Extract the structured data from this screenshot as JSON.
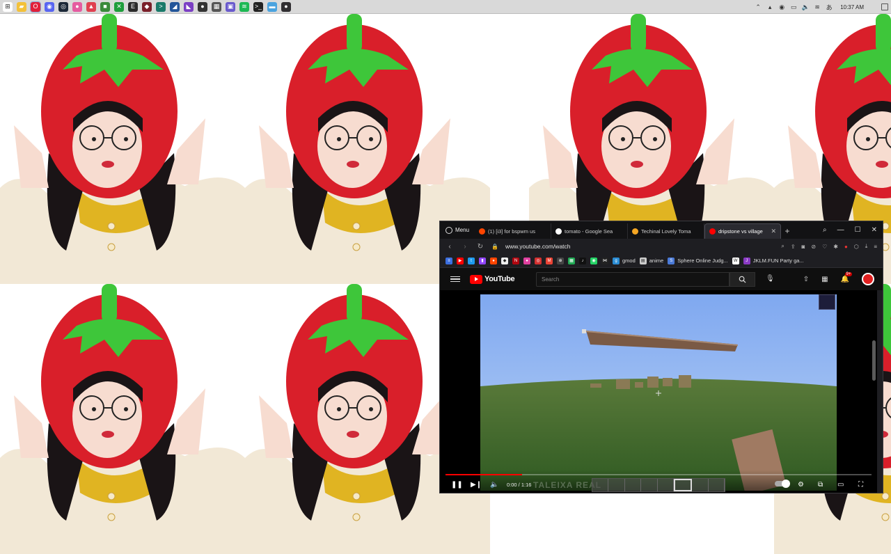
{
  "taskbar": {
    "apps": [
      {
        "name": "start-icon",
        "color": "#ffffff",
        "glyph": "⊞",
        "active": false
      },
      {
        "name": "file-explorer-icon",
        "color": "#f3c13a",
        "glyph": "▰",
        "active": false
      },
      {
        "name": "opera-icon",
        "color": "#e1203a",
        "glyph": "O",
        "active": true
      },
      {
        "name": "discord-icon",
        "color": "#5865f2",
        "glyph": "◉",
        "active": false
      },
      {
        "name": "steam-icon",
        "color": "#1b2838",
        "glyph": "◎",
        "active": false
      },
      {
        "name": "osu-icon",
        "color": "#e55ba0",
        "glyph": "●",
        "active": false
      },
      {
        "name": "app-red-icon",
        "color": "#e04050",
        "glyph": "▲",
        "active": false
      },
      {
        "name": "minecraft-icon",
        "color": "#3a8a3a",
        "glyph": "■",
        "active": false
      },
      {
        "name": "xbox-icon",
        "color": "#1e9e3b",
        "glyph": "✕",
        "active": false
      },
      {
        "name": "epic-games-icon",
        "color": "#2a2a2a",
        "glyph": "E",
        "active": false
      },
      {
        "name": "app-dark-icon",
        "color": "#7a1f2a",
        "glyph": "◆",
        "active": false
      },
      {
        "name": "terminal-app-icon",
        "color": "#1a7a6a",
        "glyph": ">",
        "active": false
      },
      {
        "name": "app-blue-icon",
        "color": "#225599",
        "glyph": "◢",
        "active": false
      },
      {
        "name": "visual-studio-icon",
        "color": "#7b3fc4",
        "glyph": "◣",
        "active": false
      },
      {
        "name": "github-icon",
        "color": "#333333",
        "glyph": "●",
        "active": false
      },
      {
        "name": "app-gray-icon",
        "color": "#555555",
        "glyph": "▦",
        "active": false
      },
      {
        "name": "app-purple-icon",
        "color": "#6a5acd",
        "glyph": "▣",
        "active": false
      },
      {
        "name": "spotify-icon",
        "color": "#1db954",
        "glyph": "≋",
        "active": false
      },
      {
        "name": "cmd-icon",
        "color": "#222222",
        "glyph": ">_",
        "active": false
      },
      {
        "name": "app-lightblue-icon",
        "color": "#4aa3df",
        "glyph": "▬",
        "active": false
      },
      {
        "name": "obs-icon",
        "color": "#302e31",
        "glyph": "●",
        "active": false
      }
    ],
    "tray": [
      {
        "name": "chevron-up-icon",
        "glyph": "⌃"
      },
      {
        "name": "tray-app-icon",
        "glyph": "▴"
      },
      {
        "name": "discord-tray-icon",
        "glyph": "◉"
      },
      {
        "name": "monitor-icon",
        "glyph": "▭"
      },
      {
        "name": "volume-icon",
        "glyph": "🔈"
      },
      {
        "name": "wifi-icon",
        "glyph": "≋"
      },
      {
        "name": "language-icon",
        "glyph": "あ"
      }
    ],
    "clock": "10:37 AM"
  },
  "browser": {
    "menu_label": "Menu",
    "tabs": [
      {
        "title": "(1) [i3] for bspwm us",
        "favicon_color": "#ff4500",
        "active": false
      },
      {
        "title": "tomato - Google Sea",
        "favicon_color": "#ffffff",
        "active": false
      },
      {
        "title": "Techinal Lovely Toma",
        "favicon_color": "#f5a623",
        "active": false
      },
      {
        "title": "dripstone vs village",
        "favicon_color": "#ff0000",
        "active": true
      }
    ],
    "url": "www.youtube.com/watch",
    "bookmarks": [
      {
        "name": "bookmark-blue-icon",
        "color": "#3b6fe0",
        "glyph": "≡",
        "label": ""
      },
      {
        "name": "bookmark-youtube-icon",
        "color": "#ff0000",
        "glyph": "▶",
        "label": ""
      },
      {
        "name": "bookmark-twitter-icon",
        "color": "#1d9bf0",
        "glyph": "t",
        "label": ""
      },
      {
        "name": "bookmark-twitch-icon",
        "color": "#9146ff",
        "glyph": "▮",
        "label": ""
      },
      {
        "name": "bookmark-reddit-icon",
        "color": "#ff4500",
        "glyph": "●",
        "label": ""
      },
      {
        "name": "bookmark-roblox-icon",
        "color": "#eeeeee",
        "glyph": "◆",
        "label": ""
      },
      {
        "name": "bookmark-netflix-icon",
        "color": "#b00710",
        "glyph": "N",
        "label": ""
      },
      {
        "name": "bookmark-pink-icon",
        "color": "#e040a0",
        "glyph": "●",
        "label": ""
      },
      {
        "name": "bookmark-red-icon",
        "color": "#d33030",
        "glyph": "◎",
        "label": ""
      },
      {
        "name": "bookmark-gmail-icon",
        "color": "#ea4335",
        "glyph": "M",
        "label": ""
      },
      {
        "name": "bookmark-spotify-icon",
        "color": "#444444",
        "glyph": "⊕",
        "label": ""
      },
      {
        "name": "bookmark-green-icon",
        "color": "#22aa55",
        "glyph": "▦",
        "label": ""
      },
      {
        "name": "bookmark-tiktok-icon",
        "color": "#111111",
        "glyph": "♪",
        "label": ""
      },
      {
        "name": "bookmark-whatsapp-icon",
        "color": "#25d366",
        "glyph": "◉",
        "label": ""
      },
      {
        "name": "bookmark-bow-icon",
        "color": "#222222",
        "glyph": "⋈",
        "label": ""
      },
      {
        "name": "bookmark-gmod-icon",
        "color": "#2a8cd4",
        "glyph": "g",
        "label": "gmod"
      },
      {
        "name": "bookmark-file-icon",
        "color": "#cccccc",
        "glyph": "▤",
        "label": "anime"
      },
      {
        "name": "bookmark-sphere-icon",
        "color": "#4a7ad8",
        "glyph": "S",
        "label": "Sphere Online Judg..."
      },
      {
        "name": "bookmark-w-icon",
        "color": "#ffffff",
        "glyph": "W",
        "label": ""
      },
      {
        "name": "bookmark-jklm-icon",
        "color": "#8a3ac4",
        "glyph": "J",
        "label": "JKLM.FUN Party ga..."
      }
    ]
  },
  "youtube": {
    "logo_text": "YouTube",
    "search_placeholder": "Search",
    "notification_count": "9+",
    "player": {
      "time": "0:00 / 1:16",
      "watermark": "TALEIXA REAL",
      "progress_fraction": 0.18
    }
  },
  "colors": {
    "tomato_red": "#d91f2a",
    "leaf_green": "#3ec63a",
    "sweater": "#f2e8d6",
    "collar": "#e0b422"
  }
}
